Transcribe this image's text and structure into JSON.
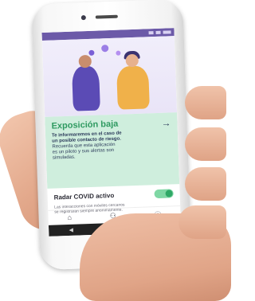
{
  "screen": {
    "exposure": {
      "title": "Exposición baja",
      "line1": "Te informaremos en el caso de",
      "line2": "un posible contacto de riesgo.",
      "line3": "Recuerda que esta aplicación",
      "line4": "es un piloto y sus alertas son",
      "line5": "simuladas.",
      "arrow": "→"
    },
    "radar": {
      "label": "Radar COVID activo",
      "desc1": "Las interacciones con móviles cercanos",
      "desc2": "se registrarán siempre anónimamente."
    },
    "nav": {
      "home": "⌂",
      "people": "⚇",
      "info": "ⓘ"
    },
    "android": {
      "back": "◀",
      "home": "●",
      "recent": "■"
    }
  },
  "colors": {
    "accent_green": "#2f9a61",
    "card_bg": "#cfeedd",
    "status_purple": "#6c5aa8"
  }
}
